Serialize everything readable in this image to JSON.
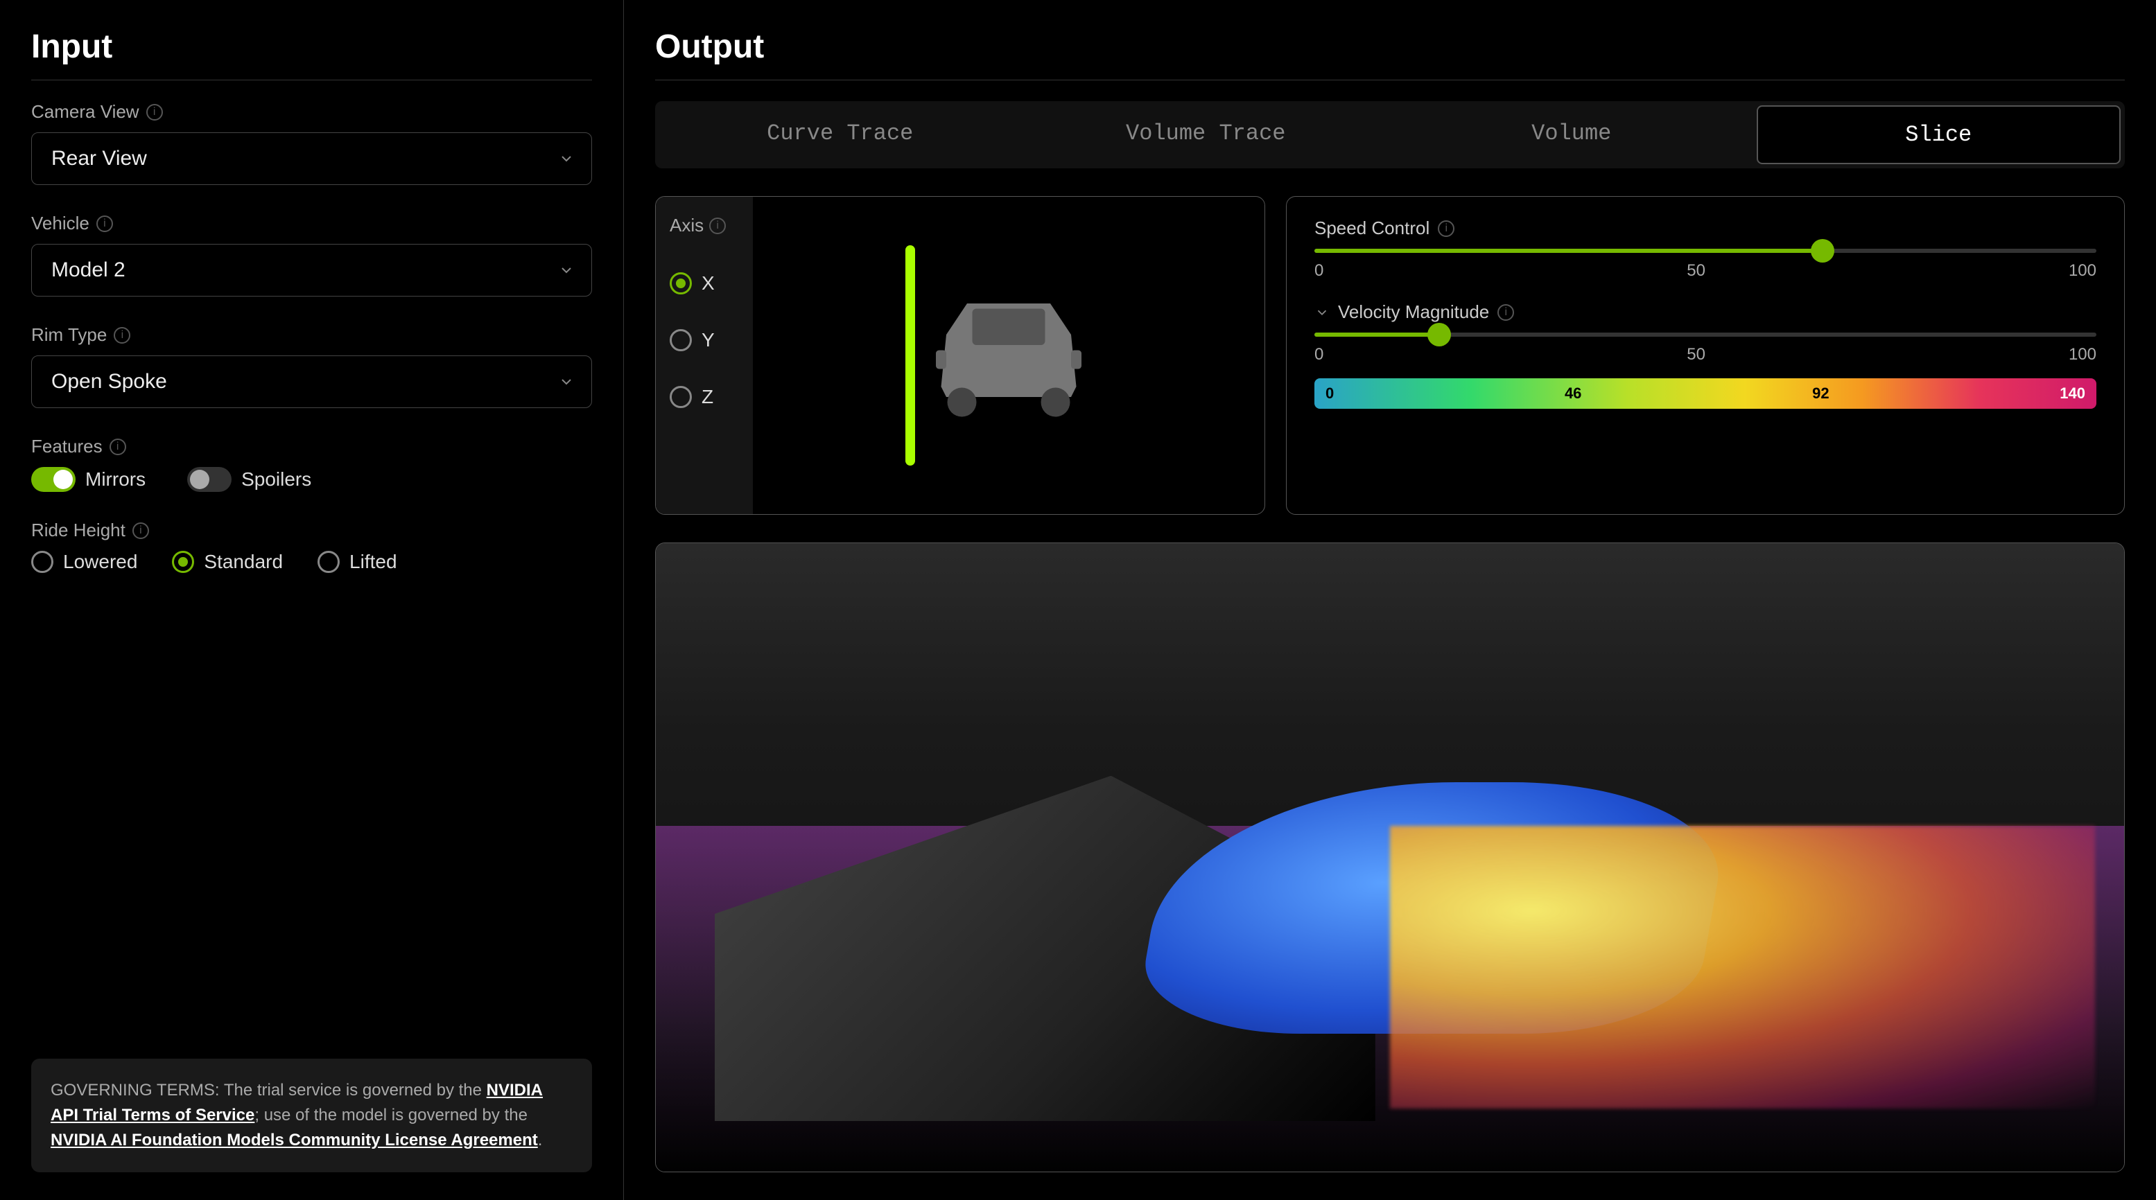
{
  "input_title": "Input",
  "output_title": "Output",
  "fields": {
    "camera_view": {
      "label": "Camera View",
      "value": "Rear View"
    },
    "vehicle": {
      "label": "Vehicle",
      "value": "Model 2"
    },
    "rim_type": {
      "label": "Rim Type",
      "value": "Open Spoke"
    },
    "features": {
      "label": "Features"
    },
    "ride_height": {
      "label": "Ride Height"
    }
  },
  "features": {
    "mirrors": {
      "label": "Mirrors",
      "enabled": true
    },
    "spoilers": {
      "label": "Spoilers",
      "enabled": false
    }
  },
  "ride_height_options": [
    {
      "label": "Lowered",
      "selected": false
    },
    {
      "label": "Standard",
      "selected": true
    },
    {
      "label": "Lifted",
      "selected": false
    }
  ],
  "terms": {
    "prefix": "GOVERNING TERMS: The trial service is governed by the ",
    "link1": "NVIDIA API Trial Terms of Service",
    "mid": "; use of the model is governed by the ",
    "link2": "NVIDIA AI Foundation Models Community License Agreement",
    "suffix": "."
  },
  "tabs": [
    {
      "label": "Curve Trace",
      "active": false
    },
    {
      "label": "Volume Trace",
      "active": false
    },
    {
      "label": "Volume",
      "active": false
    },
    {
      "label": "Slice",
      "active": true
    }
  ],
  "axis": {
    "label": "Axis",
    "options": [
      {
        "label": "X",
        "selected": true
      },
      {
        "label": "Y",
        "selected": false
      },
      {
        "label": "Z",
        "selected": false
      }
    ]
  },
  "speed_control": {
    "label": "Speed Control",
    "min": "0",
    "mid": "50",
    "max": "100",
    "value_pct": 65
  },
  "velocity_magnitude": {
    "label": "Velocity Magnitude",
    "min": "0",
    "mid": "50",
    "max": "100",
    "value_pct": 16,
    "gradient_labels": [
      "0",
      "46",
      "92",
      "140"
    ]
  },
  "colors": {
    "accent": "#76b900"
  }
}
